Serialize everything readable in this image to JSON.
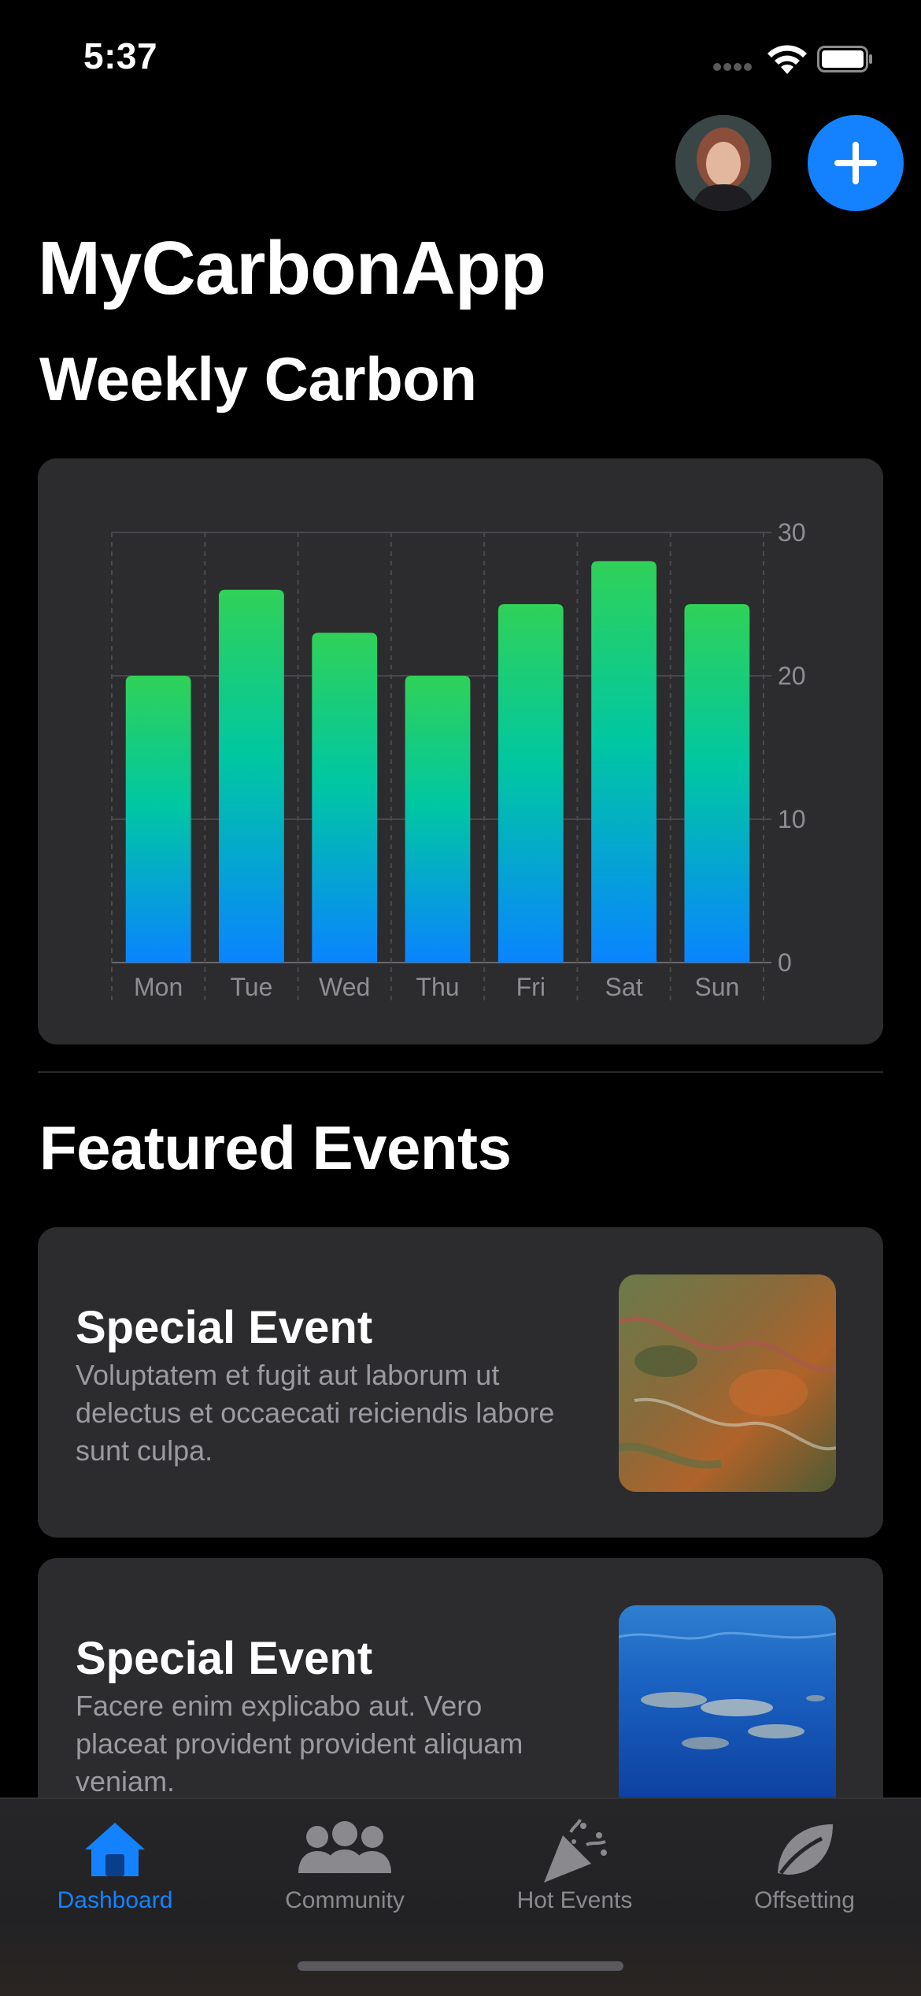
{
  "status": {
    "time": "5:37"
  },
  "header": {
    "app_title": "MyCarbonApp",
    "weekly_title": "Weekly Carbon",
    "featured_title": "Featured Events"
  },
  "chart_data": {
    "type": "bar",
    "categories": [
      "Mon",
      "Tue",
      "Wed",
      "Thu",
      "Fri",
      "Sat",
      "Sun"
    ],
    "values": [
      20,
      26,
      23,
      20,
      25,
      28,
      25
    ],
    "title": "Weekly Carbon",
    "ylim": [
      0,
      30
    ],
    "yticks": [
      "0",
      "10",
      "20",
      "30"
    ],
    "grid": true,
    "gradient": {
      "top": "#30d158",
      "mid": "#00c7a2",
      "bottom": "#0a84ff"
    }
  },
  "events": [
    {
      "title": "Special Event",
      "desc": "Voluptatem et fugit aut laborum ut delectus et occaecati reiciendis labore sunt culpa.",
      "image": "terrain-aerial-image"
    },
    {
      "title": "Special Event",
      "desc": "Facere enim explicabo aut. Vero placeat provident provident aliquam veniam.",
      "image": "dolphins-underwater-image"
    }
  ],
  "tabs": [
    {
      "label": "Dashboard",
      "icon": "house-icon",
      "active": true
    },
    {
      "label": "Community",
      "icon": "people-icon",
      "active": false
    },
    {
      "label": "Hot Events",
      "icon": "party-popper-icon",
      "active": false
    },
    {
      "label": "Offsetting",
      "icon": "leaf-icon",
      "active": false
    }
  ],
  "colors": {
    "accent": "#1482ff",
    "card": "#2c2c2e",
    "background": "#000000"
  }
}
